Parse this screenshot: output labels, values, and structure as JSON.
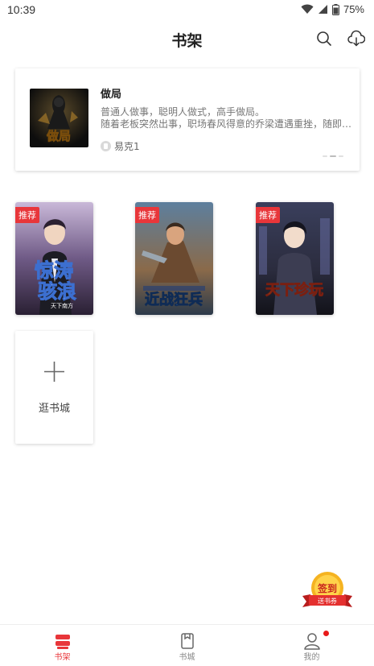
{
  "status_bar": {
    "time": "10:39",
    "battery": "75%"
  },
  "header": {
    "title": "书架",
    "search_icon": "search-icon",
    "download_icon": "cloud-download-icon"
  },
  "featured": {
    "title": "做局",
    "desc_line1": "普通人做事，聪明人做式，高手做局。",
    "desc_line2": "随着老板突然出事，职场春风得意的乔梁遭遇重挫，随即…",
    "author": "易克1",
    "cover_text": "做局"
  },
  "books": [
    {
      "badge": "推荐",
      "cover_text_top": "惊涛",
      "cover_text_bottom": "骇浪",
      "cover_sub": "天下南方"
    },
    {
      "badge": "推荐",
      "cover_text_top": "近战狂兵",
      "cover_text_bottom": "",
      "cover_sub": ""
    },
    {
      "badge": "推荐",
      "cover_text_top": "天下珍玩",
      "cover_text_bottom": "",
      "cover_sub": ""
    }
  ],
  "add_tile": {
    "label": "逛书城"
  },
  "signin": {
    "top": "签到",
    "bottom": "送书券"
  },
  "bottom_nav": [
    {
      "label": "书架",
      "icon": "bookshelf-icon",
      "active": true
    },
    {
      "label": "书城",
      "icon": "bookstore-icon",
      "active": false
    },
    {
      "label": "我的",
      "icon": "profile-icon",
      "active": false
    }
  ],
  "colors": {
    "accent": "#e8363a",
    "badge": "#e8363a",
    "text": "#222222"
  }
}
